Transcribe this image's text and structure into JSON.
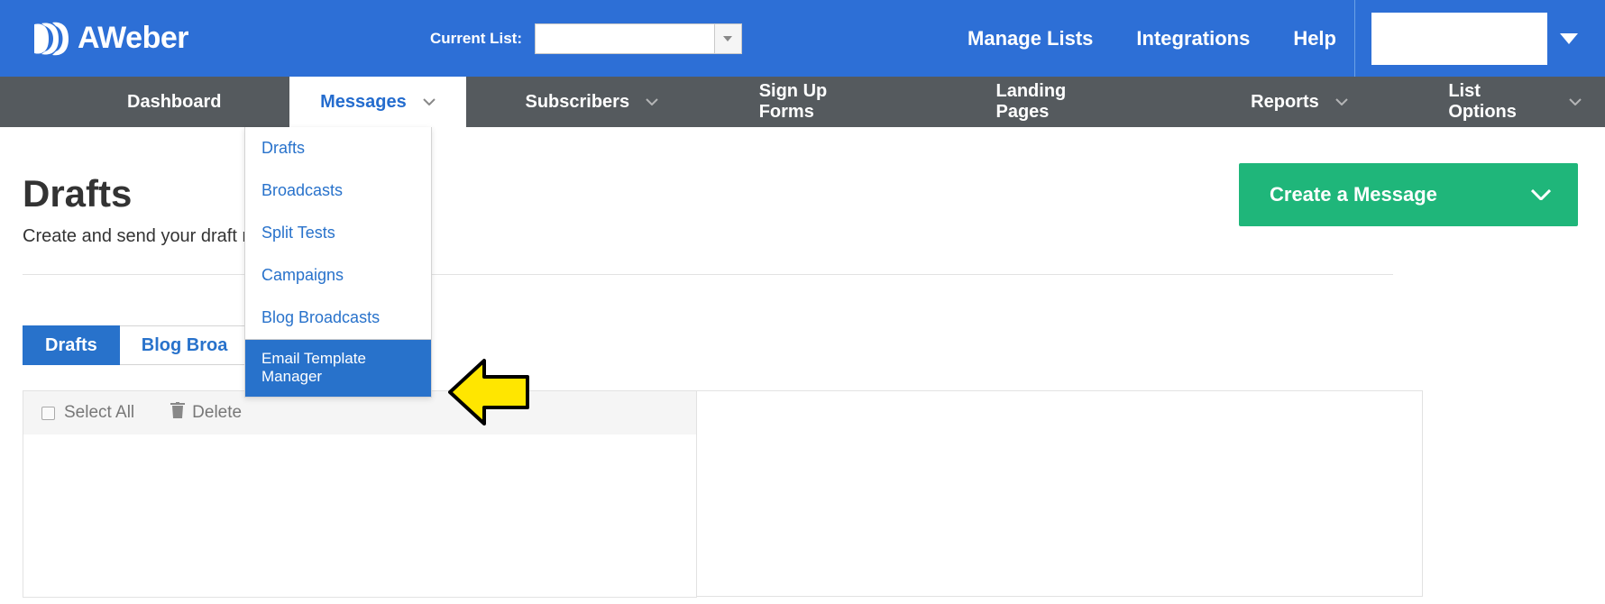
{
  "brand": {
    "name": "AWeber"
  },
  "topbar": {
    "current_list_label": "Current List:",
    "links": [
      "Manage Lists",
      "Integrations",
      "Help"
    ]
  },
  "nav": {
    "items": [
      {
        "label": "Dashboard",
        "has_chevron": false
      },
      {
        "label": "Messages",
        "has_chevron": true,
        "active": true
      },
      {
        "label": "Subscribers",
        "has_chevron": true
      },
      {
        "label": "Sign Up Forms",
        "has_chevron": false
      },
      {
        "label": "Landing Pages",
        "has_chevron": false
      },
      {
        "label": "Reports",
        "has_chevron": true
      },
      {
        "label": "List Options",
        "has_chevron": true
      }
    ]
  },
  "dropdown": {
    "items": [
      "Drafts",
      "Broadcasts",
      "Split Tests",
      "Campaigns",
      "Blog Broadcasts"
    ],
    "selected": "Email Template Manager"
  },
  "page": {
    "title": "Drafts",
    "subtitle": "Create and send your draft me",
    "create_button": "Create a Message"
  },
  "tabs": {
    "active": "Drafts",
    "inactive": "Blog Broa"
  },
  "table": {
    "select_all": "Select All",
    "delete": "Delete"
  }
}
